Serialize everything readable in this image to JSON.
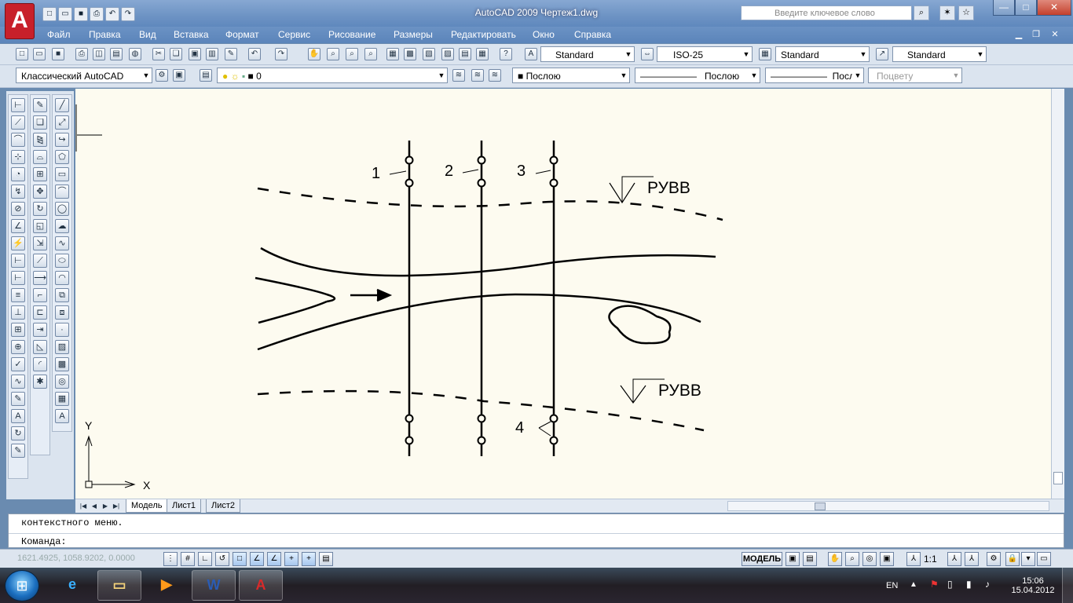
{
  "window": {
    "title": "AutoCAD 2009 Чертеж1.dwg",
    "search_placeholder": "Введите ключевое слово",
    "min": "—",
    "max": "□",
    "close": "✕"
  },
  "menu": [
    "Файл",
    "Правка",
    "Вид",
    "Вставка",
    "Формат",
    "Сервис",
    "Рисование",
    "Размеры",
    "Редактировать",
    "Окно",
    "Справка"
  ],
  "toolbar": {
    "text_style": "Standard",
    "dim_style": "ISO-25",
    "table_style": "Standard",
    "mleader_style": "Standard",
    "workspace": "Классический AutoCAD",
    "layer": "0",
    "color": "Послою",
    "linetype": "Послою",
    "lineweight": "Послою",
    "plotstyle": "Поцвету"
  },
  "drawing": {
    "labels": [
      "1",
      "2",
      "3",
      "4"
    ],
    "water_level": "РУВВ",
    "ucs_x": "X",
    "ucs_y": "Y"
  },
  "layout_tabs": [
    "Модель",
    "Лист1",
    "Лист2"
  ],
  "command": {
    "history": "контекстного меню.",
    "prompt": "Команда:"
  },
  "status": {
    "coords": "1621.4925, 1058.9202, 0.0000",
    "model": "МОДЕЛЬ",
    "scale": "1:1"
  },
  "taskbar": {
    "lang": "EN",
    "time": "15:06",
    "date": "15.04.2012"
  },
  "colors": {
    "canvas": "#fdfbf0",
    "titlebar": "#6d93c4",
    "autocad_red": "#c8202a"
  }
}
